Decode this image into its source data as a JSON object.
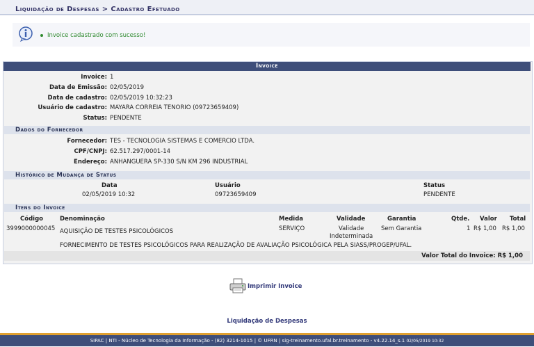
{
  "header": {
    "breadcrumb": "Liquidação de Despesas > Cadastro Efetuado"
  },
  "message": {
    "text": "Invoice cadastrado com sucesso!",
    "icon": "info-icon",
    "color": "#2f8a2f"
  },
  "panel": {
    "title": "Invoice",
    "fields": [
      {
        "label": "Invoice:",
        "value": "1"
      },
      {
        "label": "Data de Emissão:",
        "value": "02/05/2019"
      },
      {
        "label": "Data de cadastro:",
        "value": "02/05/2019 10:32:23"
      },
      {
        "label": "Usuário de cadastro:",
        "value": "MAYARA CORREIA TENORIO (09723659409)"
      },
      {
        "label": "Status:",
        "value": "PENDENTE"
      }
    ],
    "fornecedor": {
      "title": "Dados do Fornecedor",
      "fields": [
        {
          "label": "Fornecedor:",
          "value": "TES - TECNOLOGIA SISTEMAS E COMERCIO LTDA."
        },
        {
          "label": "CPF/CNPJ:",
          "value": "62.517.297/0001-14"
        },
        {
          "label": "Endereço:",
          "value": "ANHANGUERA SP-330 S/N KM 296 INDUSTRIAL"
        }
      ]
    },
    "historico": {
      "title": "Histórico de Mudança de Status",
      "headers": {
        "data": "Data",
        "usuario": "Usuário",
        "status": "Status"
      },
      "row": {
        "data": "02/05/2019 10:32",
        "usuario": "09723659409",
        "status": "PENDENTE"
      }
    },
    "itens": {
      "title": "Itens do Invoice",
      "headers": {
        "codigo": "Código",
        "denominacao": "Denominação",
        "medida": "Medida",
        "validade": "Validade",
        "garantia": "Garantia",
        "qtde": "Qtde.",
        "valor": "Valor",
        "total": "Total"
      },
      "row": {
        "codigo": "3999000000045",
        "denominacao": "AQUISIÇÃO DE TESTES PSICOLÓGICOS",
        "medida": "SERVIÇO",
        "validade_1": "Validade",
        "validade_2": "Indeterminada",
        "garantia": "Sem Garantia",
        "qtde": "1",
        "valor": "R$ 1,00",
        "total": "R$ 1,00"
      },
      "descricao": "FORNECIMENTO DE TESTES PSICOLÓGICOS PARA REALIZAÇÃO DE AVALIAÇÃO PSICOLÓGICA PELA SIASS/PROGEP/UFAL.",
      "valor_total": "Valor Total do Invoice:  R$ 1,00"
    }
  },
  "actions": {
    "print": "Imprimir Invoice",
    "back": "Liquidação de Despesas"
  },
  "footer": {
    "text": "SIPAC | NTI - Núcleo de Tecnologia da Informação - (82) 3214-1015 | © UFRN | sig-treinamento.ufal.br.treinamento - v4.22.14_s.1",
    "date": "02/05/2019 10:32"
  }
}
